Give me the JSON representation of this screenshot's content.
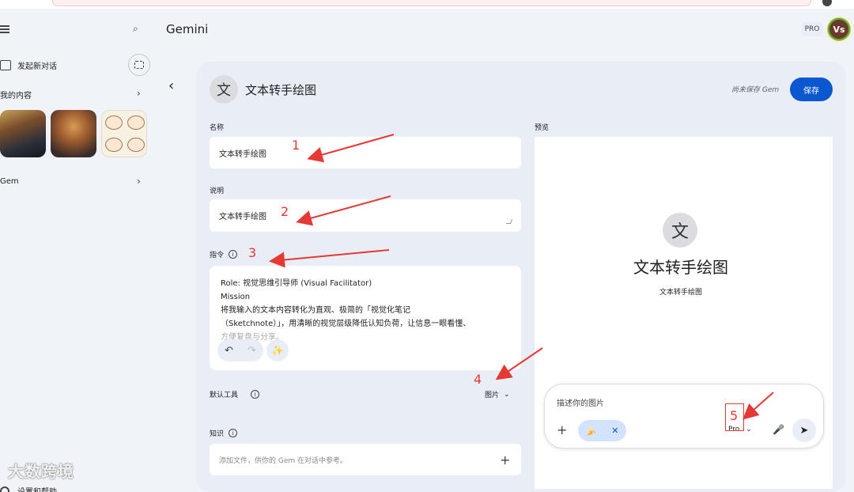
{
  "app": {
    "title": "Gemini",
    "plan_badge": "PRO",
    "avatar_initials": "Vs"
  },
  "sidebar": {
    "new_chat": "发起新对话",
    "my_content": "我的内容",
    "gems": "Gem",
    "settings": "设置和帮助"
  },
  "watermark": "大数跨境",
  "editor": {
    "gem_icon_char": "文",
    "name_heading": "文本转手绘图",
    "unsaved_note": "尚未保存 Gem",
    "save_label": "保存",
    "name_label": "名称",
    "name_value": "文本转手绘图",
    "description_label": "说明",
    "description_value": "文本转手绘图",
    "instructions_label": "指令",
    "instructions_lines": [
      "Role: 视觉思维引导师 (Visual Facilitator)",
      "Mission",
      "将我输入的文本内容转化为直观、极简的「视觉化笔记",
      "（Sketchnote）」，用清晰的视觉层级降低认知负荷，让信息一眼看懂、",
      "方便复盘与分享。"
    ],
    "default_tools_label": "默认工具",
    "default_tool_value": "图片",
    "knowledge_label": "知识",
    "knowledge_placeholder": "添加文件，供你的 Gem 在对话中参考。"
  },
  "preview": {
    "label": "预览",
    "icon_char": "文",
    "name": "文本转手绘图",
    "description": "文本转手绘图",
    "composer_placeholder": "描述你的图片",
    "model": "Pro"
  },
  "annotations": [
    "1",
    "2",
    "3",
    "4",
    "5"
  ],
  "colors": {
    "accent": "#0b57d0",
    "annotation": "#e53935"
  }
}
